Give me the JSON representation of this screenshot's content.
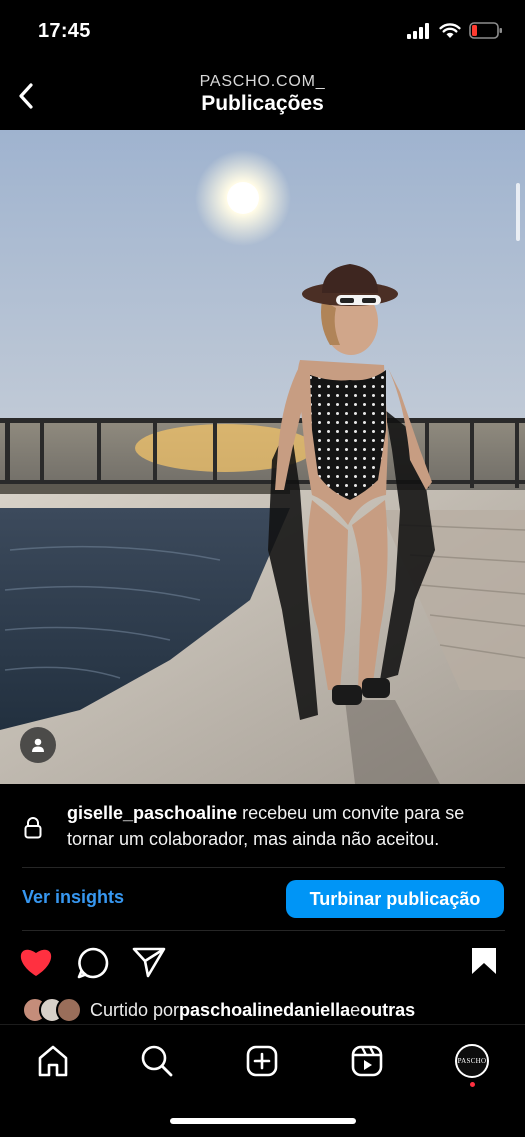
{
  "status_bar": {
    "time": "17:45",
    "battery_color": "#ff3b30"
  },
  "header": {
    "account": "PASCHO.COM_",
    "title": "Publicações",
    "back_icon": "chevron-left-icon"
  },
  "collab_notice": {
    "username": "giselle_paschoaline",
    "message": " recebeu um convite para se tornar um colaborador, mas ainda não aceitou.",
    "icon": "lock-icon"
  },
  "insights_link": "Ver insights",
  "boost_button": "Turbinar publicação",
  "actions": {
    "like_color": "#ff3040",
    "liked": true,
    "saved": true
  },
  "likes": {
    "prefix": "Curtido por ",
    "user": "paschoalinedaniella",
    "connector": " e ",
    "others": "outras"
  },
  "tabs": [
    "home-icon",
    "search-icon",
    "create-icon",
    "reels-icon",
    "profile-avatar"
  ],
  "profile_avatar_text": "PASCHO",
  "colors": {
    "accent": "#0095f6",
    "link": "#3797f0",
    "background": "#000000"
  }
}
